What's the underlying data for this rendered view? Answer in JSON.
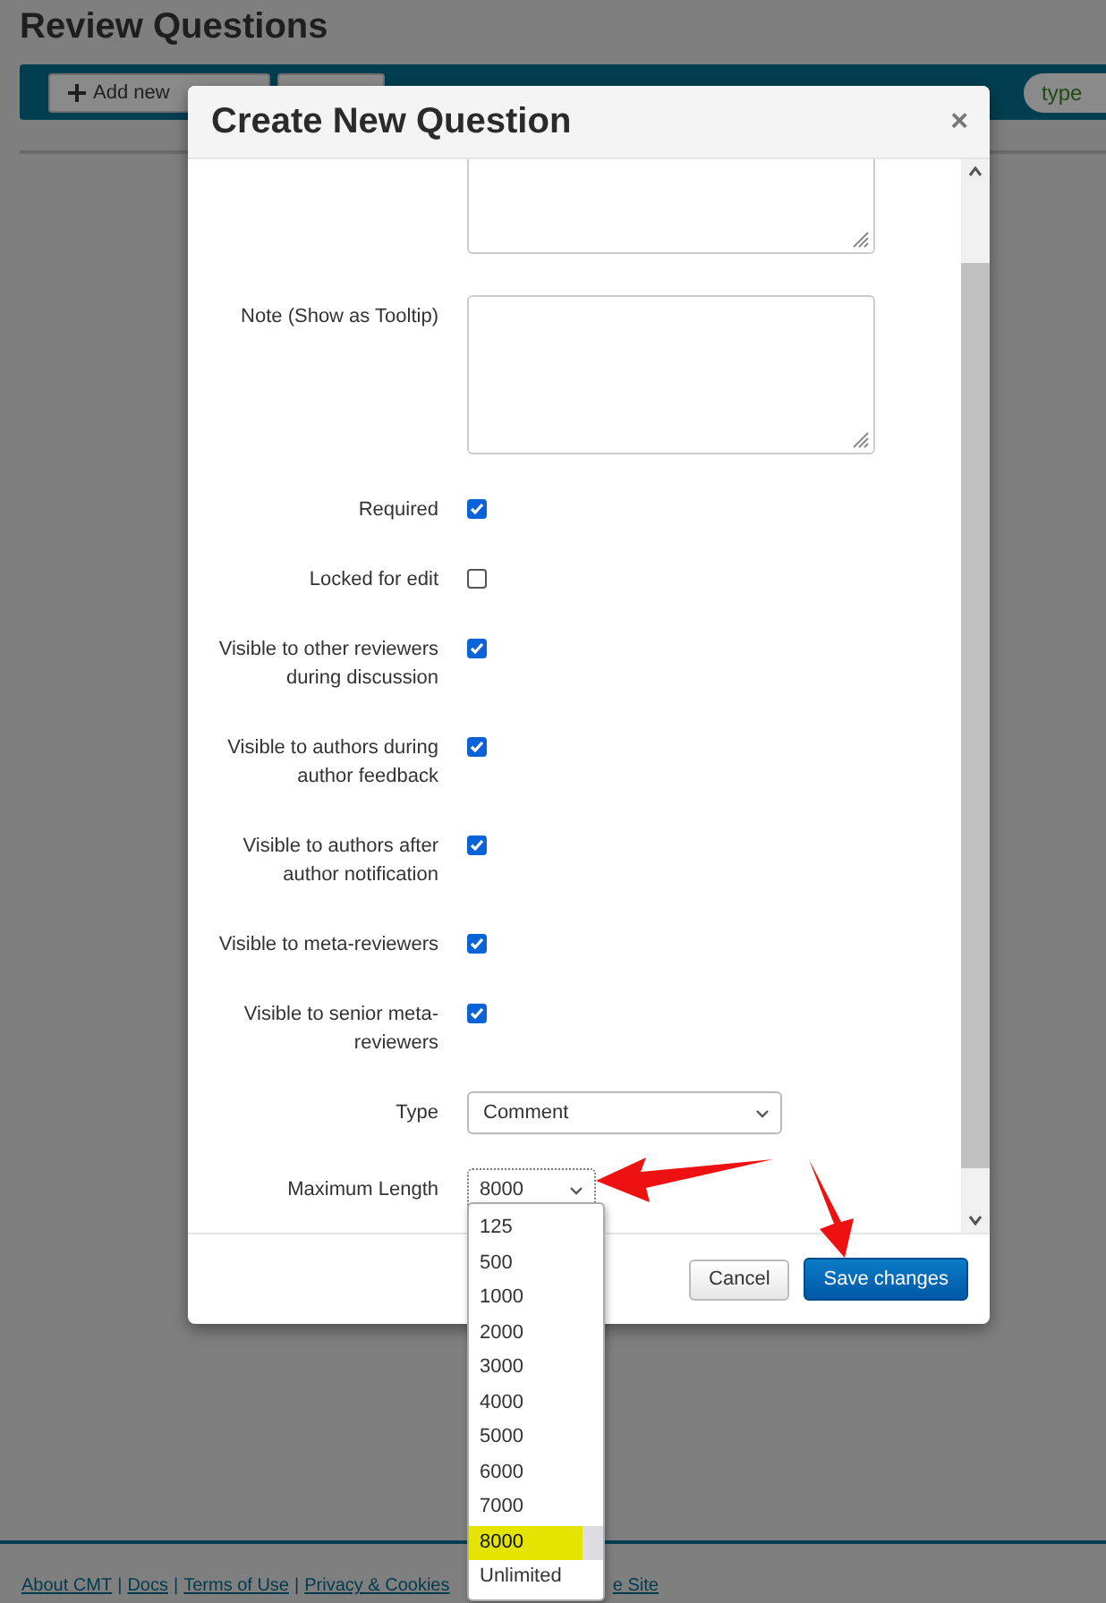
{
  "page": {
    "title": "Review Questions",
    "toolbar": {
      "add_button": "Add new",
      "filter_pill": "type"
    },
    "footer": {
      "links": [
        "About CMT",
        "Docs",
        "Terms of Use",
        "Privacy & Cookies"
      ],
      "separator": "|",
      "cut_link": "e Site"
    }
  },
  "dialog": {
    "title": "Create New Question",
    "close": "×",
    "fields": [
      {
        "kind": "textarea"
      },
      {
        "kind": "textarea",
        "label": "Note (Show as Tooltip)"
      },
      {
        "kind": "checkbox",
        "label": "Required",
        "checked": true
      },
      {
        "kind": "checkbox",
        "label": "Locked for edit",
        "checked": false
      },
      {
        "kind": "checkbox",
        "label": "Visible to other reviewers during discussion",
        "checked": true
      },
      {
        "kind": "checkbox",
        "label": "Visible to authors during author feedback",
        "checked": true
      },
      {
        "kind": "checkbox",
        "label": "Visible to authors after author notification",
        "checked": true
      },
      {
        "kind": "checkbox",
        "label": "Visible to meta-reviewers",
        "checked": true
      },
      {
        "kind": "checkbox",
        "label": "Visible to senior meta-reviewers",
        "checked": true
      },
      {
        "kind": "select",
        "label": "Type",
        "value": "Comment",
        "open": false
      },
      {
        "kind": "select",
        "label": "Maximum Length",
        "value": "8000",
        "open": true,
        "options": [
          {
            "label": "125",
            "selected": false
          },
          {
            "label": "500",
            "selected": false
          },
          {
            "label": "1000",
            "selected": false
          },
          {
            "label": "2000",
            "selected": false
          },
          {
            "label": "3000",
            "selected": false
          },
          {
            "label": "4000",
            "selected": false
          },
          {
            "label": "5000",
            "selected": false
          },
          {
            "label": "6000",
            "selected": false
          },
          {
            "label": "7000",
            "selected": false
          },
          {
            "label": "8000",
            "selected": true
          },
          {
            "label": "Unlimited",
            "selected": false
          }
        ]
      }
    ],
    "buttons": [
      {
        "label": "Cancel",
        "kind": "default"
      },
      {
        "label": "Save changes",
        "kind": "primary"
      }
    ]
  }
}
